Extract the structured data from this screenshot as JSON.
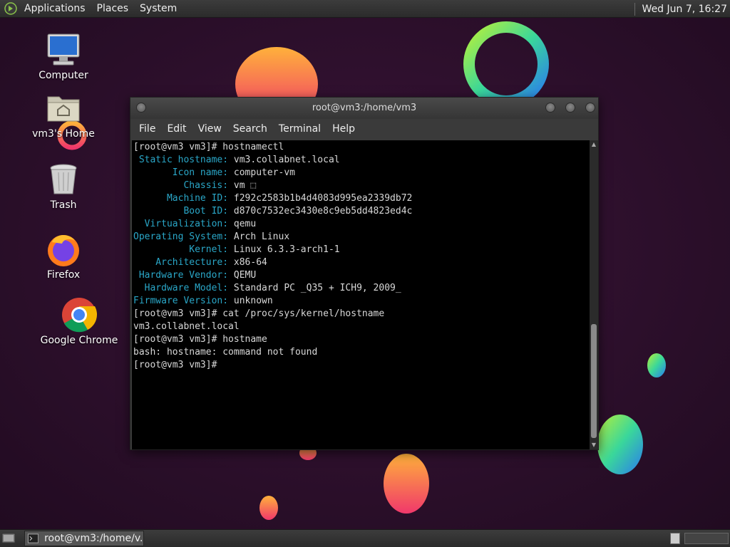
{
  "top_panel": {
    "menus": [
      "Applications",
      "Places",
      "System"
    ],
    "clock": "Wed Jun  7, 16:27"
  },
  "desktop_icons": [
    {
      "label": "Computer",
      "icon": "computer-icon"
    },
    {
      "label": "vm3's Home",
      "icon": "home-folder-icon"
    },
    {
      "label": "Trash",
      "icon": "trash-icon"
    },
    {
      "label": "Firefox",
      "icon": "firefox-icon"
    },
    {
      "label": "Google Chrome",
      "icon": "chrome-icon"
    }
  ],
  "terminal": {
    "title": "root@vm3:/home/vm3",
    "menus": [
      "File",
      "Edit",
      "View",
      "Search",
      "Terminal",
      "Help"
    ],
    "lines": [
      {
        "key": "",
        "value": "[root@vm3 vm3]# hostnamectl"
      },
      {
        "key": " Static hostname:",
        "value": " vm3.collabnet.local"
      },
      {
        "key": "       Icon name:",
        "value": " computer-vm"
      },
      {
        "key": "         Chassis:",
        "value": " vm ⬚"
      },
      {
        "key": "      Machine ID:",
        "value": " f292c2583b1b4d4083d995ea2339db72"
      },
      {
        "key": "         Boot ID:",
        "value": " d870c7532ec3430e8c9eb5dd4823ed4c"
      },
      {
        "key": "  Virtualization:",
        "value": " qemu"
      },
      {
        "key": "Operating System:",
        "value": " Arch Linux"
      },
      {
        "key": "          Kernel:",
        "value": " Linux 6.3.3-arch1-1"
      },
      {
        "key": "    Architecture:",
        "value": " x86-64"
      },
      {
        "key": " Hardware Vendor:",
        "value": " QEMU"
      },
      {
        "key": "  Hardware Model:",
        "value": " Standard PC _Q35 + ICH9, 2009_"
      },
      {
        "key": "Firmware Version:",
        "value": " unknown"
      },
      {
        "key": "",
        "value": "[root@vm3 vm3]# cat /proc/sys/kernel/hostname"
      },
      {
        "key": "",
        "value": "vm3.collabnet.local"
      },
      {
        "key": "",
        "value": "[root@vm3 vm3]# hostname"
      },
      {
        "key": "",
        "value": "bash: hostname: command not found"
      },
      {
        "key": "",
        "value": "[root@vm3 vm3]#"
      }
    ]
  },
  "taskbar": {
    "window_label": "root@vm3:/home/v..."
  },
  "colors": {
    "terminal_key": "#2aa7c8",
    "terminal_text": "#d8d8d8",
    "wallpaper_base": "#2a0e2a"
  }
}
